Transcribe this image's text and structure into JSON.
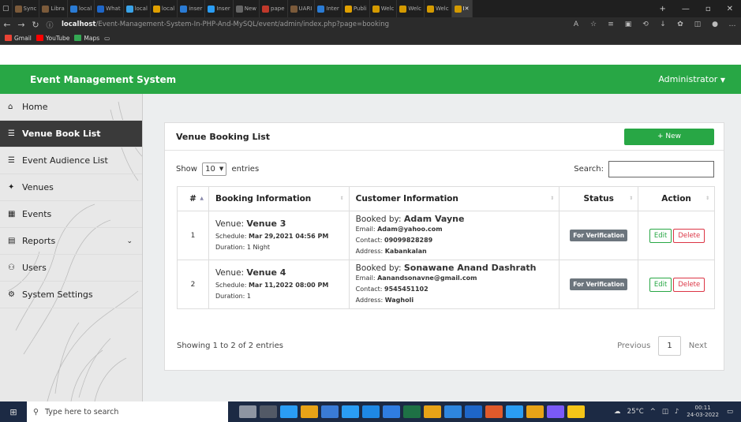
{
  "browser": {
    "tabs": [
      {
        "label": "Sync",
        "color": "#7b5a3a"
      },
      {
        "label": "Libra",
        "color": "#7b5a3a"
      },
      {
        "label": "local",
        "color": "#2a7bd4"
      },
      {
        "label": "What",
        "color": "#1e66c8"
      },
      {
        "label": "local",
        "color": "#3aa3e8"
      },
      {
        "label": "local",
        "color": "#e0a000"
      },
      {
        "label": "inser",
        "color": "#2a7bd4"
      },
      {
        "label": "Inser",
        "color": "#2a9df4"
      },
      {
        "label": "New",
        "color": "#666666"
      },
      {
        "label": "pape",
        "color": "#c0392b"
      },
      {
        "label": "UARI",
        "color": "#7b5a3a"
      },
      {
        "label": "Inter",
        "color": "#2a7bd4"
      },
      {
        "label": "Publi",
        "color": "#e0a000"
      },
      {
        "label": "Welc",
        "color": "#d49a00"
      },
      {
        "label": "Welc",
        "color": "#d49a00"
      },
      {
        "label": "Welc",
        "color": "#d49a00"
      }
    ],
    "active_tab": {
      "label": "I",
      "color": "#d49a00"
    },
    "url_host": "localhost",
    "url_path": "/Event-Management-System-In-PHP-And-MySQL/event/admin/index.php?page=booking",
    "bookmarks": [
      {
        "label": "Gmail",
        "color": "#ea4335"
      },
      {
        "label": "YouTube",
        "color": "#ff0000"
      },
      {
        "label": "Maps",
        "color": "#34a853"
      }
    ]
  },
  "app": {
    "title": "Event Management System",
    "user": "Administrator",
    "accent": "#28a745"
  },
  "sidebar": {
    "items": [
      {
        "label": "Home",
        "icon": "home-icon",
        "glyph": "⌂"
      },
      {
        "label": "Venue Book List",
        "icon": "list-icon",
        "glyph": "☰"
      },
      {
        "label": "Event Audience List",
        "icon": "list-icon",
        "glyph": "☰"
      },
      {
        "label": "Venues",
        "icon": "venues-icon",
        "glyph": "✦"
      },
      {
        "label": "Events",
        "icon": "calendar-icon",
        "glyph": "▦"
      },
      {
        "label": "Reports",
        "icon": "file-icon",
        "glyph": "▤"
      },
      {
        "label": "Users",
        "icon": "users-icon",
        "glyph": "⚇"
      },
      {
        "label": "System Settings",
        "icon": "cogs-icon",
        "glyph": "⚙"
      }
    ]
  },
  "card": {
    "title": "Venue Booking List",
    "new_label": "+ New"
  },
  "table_controls": {
    "show_label": "Show",
    "entries_value": "10",
    "entries_label": "entries",
    "search_label": "Search:"
  },
  "table": {
    "headers": [
      "#",
      "Booking Information",
      "Customer Information",
      "Status",
      "Action"
    ],
    "rows": [
      {
        "num": "1",
        "venue_label": "Venue:",
        "venue": "Venue 3",
        "schedule_label": "Schedule:",
        "schedule": "Mar 29,2021 04:56 PM",
        "duration": "Duration: 1 Night",
        "booked_label": "Booked by:",
        "booked_by": "Adam Vayne",
        "email_label": "Email:",
        "email": "Adam@yahoo.com",
        "contact_label": "Contact:",
        "contact": "09099828289",
        "address_label": "Address:",
        "address": "Kabankalan",
        "status": "For Verification",
        "edit": "Edit",
        "delete": "Delete"
      },
      {
        "num": "2",
        "venue_label": "Venue:",
        "venue": "Venue 4",
        "schedule_label": "Schedule:",
        "schedule": "Mar 11,2022 08:00 PM",
        "duration": "Duration: 1",
        "booked_label": "Booked by:",
        "booked_by": "Sonawane Anand Dashrath",
        "email_label": "Email:",
        "email": "Aanandsonavne@gmail.com",
        "contact_label": "Contact:",
        "contact": "9545451102",
        "address_label": "Address:",
        "address": "Wagholi",
        "status": "For Verification",
        "edit": "Edit",
        "delete": "Delete"
      }
    ]
  },
  "table_footer": {
    "info": "Showing 1 to 2 of 2 entries",
    "previous": "Previous",
    "page": "1",
    "next": "Next"
  },
  "taskbar": {
    "search_placeholder": "Type here to search",
    "weather": "25°C",
    "time": "00:11",
    "date": "24-03-2022",
    "app_colors": [
      "#ffffff",
      "#888888",
      "#2a9df4",
      "#e8a317",
      "#3a7bd5",
      "#2a9df4",
      "#1e88e5",
      "#2f7de1",
      "#1e7145",
      "#e8a317",
      "#2e86de",
      "#1e66c8",
      "#e05a2b",
      "#2a9df4",
      "#e8a317",
      "#7a5af8",
      "#f5c518"
    ]
  }
}
